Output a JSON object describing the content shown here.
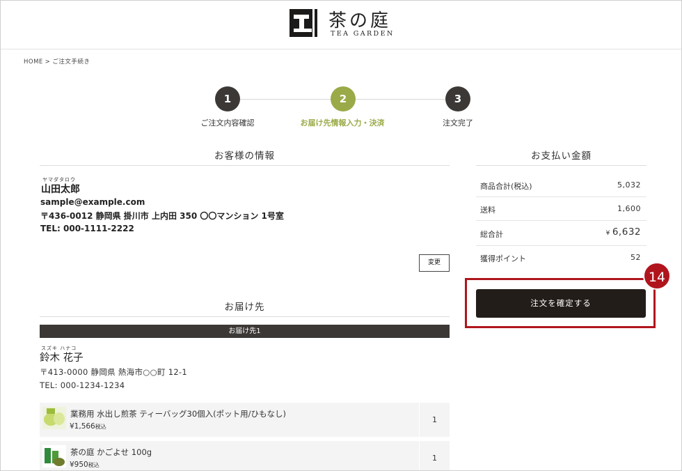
{
  "header": {
    "logo_name": "茶の庭",
    "logo_sub": "TEA GARDEN"
  },
  "breadcrumb": {
    "home": "HOME",
    "separator": ">",
    "current": "ご注文手続き"
  },
  "steps": [
    {
      "number": "1",
      "label": "ご注文内容確認",
      "state": "done",
      "color": "#3b3836"
    },
    {
      "number": "2",
      "label": "お届け先情報入力・決済",
      "state": "current",
      "color": "#9aaa48"
    },
    {
      "number": "3",
      "label": "注文完了",
      "state": "pending",
      "color": "#3b3836"
    }
  ],
  "customer": {
    "section_title": "お客様の情報",
    "ruby": "ヤマダタロウ",
    "name": "山田太郎",
    "email": "sample@example.com",
    "address": "〒436-0012 静岡県 掛川市 上内田 350 〇〇マンション 1号室",
    "tel": "TEL: 000-1111-2222",
    "change_button": "変更"
  },
  "delivery": {
    "section_title": "お届け先",
    "destination_label": "お届け先1",
    "ruby": "スズキ ハナコ",
    "name": "鈴木 花子",
    "address": "〒413-0000 静岡県 熱海市○○町 12-1",
    "tel": "TEL: 000-1234-1234",
    "items": [
      {
        "name": "業務用 水出し煎茶 ティーバッグ30個入(ポット用/ひもなし)",
        "price": "¥1,566",
        "tax": "税込",
        "quantity": "1",
        "thumb_icon": "tea-bag-product-icon"
      },
      {
        "name": "茶の庭 かごよせ 100g",
        "price": "¥950",
        "tax": "税込",
        "quantity": "1",
        "thumb_icon": "tea-leaf-product-icon"
      }
    ]
  },
  "payment": {
    "section_title": "お支払い金額",
    "rows": [
      {
        "label": "商品合計(税込)",
        "value": "5,032"
      },
      {
        "label": "送料",
        "value": "1,600"
      },
      {
        "label": "総合計",
        "currency": "¥",
        "value": "6,632"
      },
      {
        "label": "獲得ポイント",
        "value": "52"
      }
    ],
    "confirm_button": "注文を確定する"
  },
  "annotation": {
    "badge": "14",
    "color": "#b0151d"
  }
}
